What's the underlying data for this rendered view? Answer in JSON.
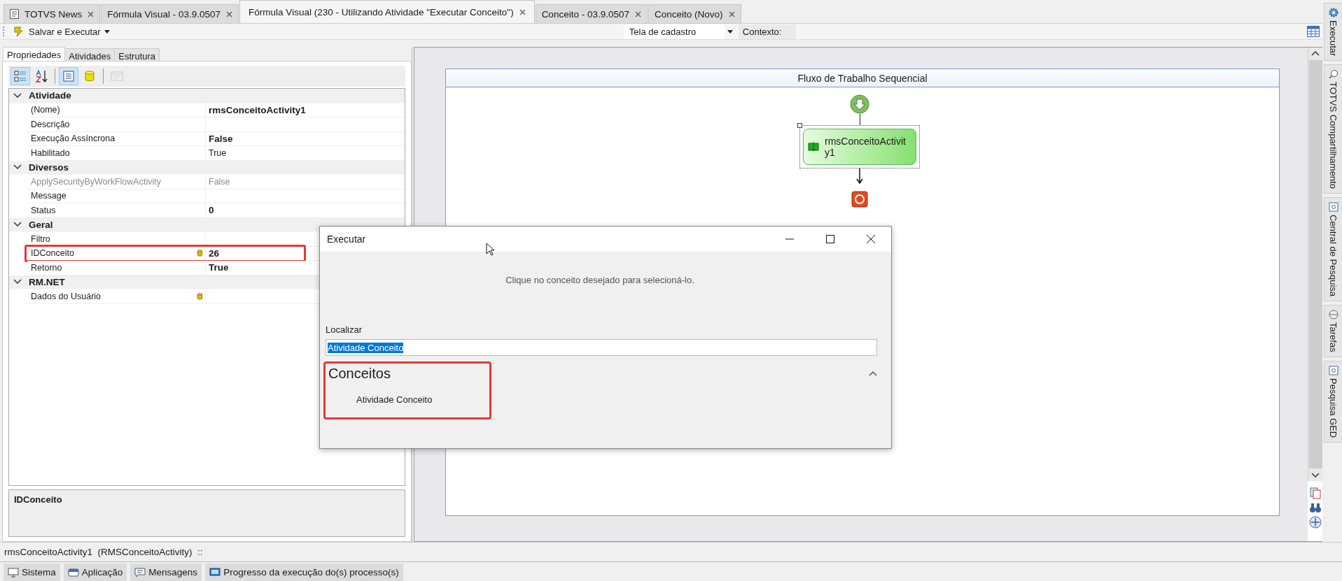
{
  "document_tabs": [
    {
      "label": "TOTVS News",
      "selected": false,
      "kind": "news"
    },
    {
      "label": "Fórmula Visual - 03.9.0507",
      "selected": false,
      "kind": "plain"
    },
    {
      "label": "Fórmula Visual (230 - Utilizando Atividade \"Executar Conceito\")",
      "selected": true,
      "kind": "plain"
    },
    {
      "label": "Conceito - 03.9.0507",
      "selected": false,
      "kind": "plain"
    },
    {
      "label": "Conceito (Novo)",
      "selected": false,
      "kind": "plain"
    }
  ],
  "toolbar": {
    "run_button": "Salvar e Executar",
    "screen_select": "Tela de cadastro",
    "context_label": "Contexto:"
  },
  "left_panel": {
    "tabs": [
      {
        "label": "Propriedades",
        "selected": true
      },
      {
        "label": "Atividades",
        "selected": false
      },
      {
        "label": "Estrutura",
        "selected": false
      }
    ],
    "grid_tools": [
      {
        "kind": "categorized",
        "selected": true,
        "disabled": false
      },
      {
        "kind": "alphabetical",
        "selected": false,
        "disabled": false
      },
      {
        "kind": "properties",
        "selected": true,
        "disabled": false
      },
      {
        "kind": "database",
        "selected": false,
        "disabled": false
      },
      {
        "kind": "events",
        "selected": false,
        "disabled": true
      }
    ],
    "categories": [
      {
        "name": "Atividade",
        "expanded": true,
        "properties": [
          {
            "name": "(Nome)",
            "value": "rmsConceitoActivity1",
            "modified": true,
            "disabled": false,
            "bound": false,
            "highlighted": false
          },
          {
            "name": "Descrição",
            "disabled": false,
            "bound": false,
            "highlighted": false
          },
          {
            "name": "Execução Assíncrona",
            "value": "False",
            "modified": true,
            "disabled": false,
            "bound": false,
            "highlighted": false
          },
          {
            "name": "Habilitado",
            "value": "True",
            "modified": false,
            "disabled": false,
            "bound": false,
            "highlighted": false
          }
        ]
      },
      {
        "name": "Diversos",
        "expanded": true,
        "properties": [
          {
            "name": "ApplySecurityByWorkFlowActivity",
            "value": "False",
            "modified": false,
            "disabled": true,
            "bound": false,
            "highlighted": false
          },
          {
            "name": "Message",
            "disabled": false,
            "bound": false,
            "highlighted": false
          },
          {
            "name": "Status",
            "value": "0",
            "modified": true,
            "disabled": false,
            "bound": false,
            "highlighted": false
          }
        ]
      },
      {
        "name": "Geral",
        "expanded": true,
        "properties": [
          {
            "name": "Filtro",
            "disabled": false,
            "bound": false,
            "highlighted": false
          },
          {
            "name": "IDConceito",
            "value": "26",
            "modified": true,
            "disabled": false,
            "bound": true,
            "highlighted": true
          },
          {
            "name": "Retorno",
            "value": "True",
            "modified": true,
            "disabled": false,
            "bound": false,
            "highlighted": false
          }
        ]
      },
      {
        "name": "RM.NET",
        "expanded": true,
        "properties": [
          {
            "name": "Dados do Usuário",
            "disabled": false,
            "bound": true,
            "highlighted": false
          }
        ]
      }
    ],
    "help": {
      "title": "IDConceito"
    }
  },
  "designer": {
    "title": "Fluxo de Trabalho Sequencial",
    "activity": {
      "label": "rmsConceitoActivity1",
      "selected": true
    }
  },
  "dialog": {
    "title": "Executar",
    "hint": "Clique no conceito desejado para selecioná-lo.",
    "search_label": "Localizar",
    "search_value": "Atividade Conceito",
    "text_selected": true,
    "group": {
      "title": "Conceitos",
      "expanded": true,
      "highlighted": true,
      "items": [
        "Atividade Conceito"
      ]
    }
  },
  "side_tabs": [
    {
      "label": "Executar",
      "kind": "gear"
    },
    {
      "label": "TOTVS Compartilhamento",
      "kind": "search"
    },
    {
      "label": "Central de Pesquisa",
      "kind": "doc"
    },
    {
      "label": "Tarefas",
      "kind": "pin"
    },
    {
      "label": "Pesquisa GED",
      "kind": "doc"
    }
  ],
  "status_line": "rmsConceitoActivity1  (RMSConceitoActivity)  ::",
  "bottom_tabs": [
    {
      "label": "Sistema",
      "kind": "monitor"
    },
    {
      "label": "Aplicação",
      "kind": "window"
    },
    {
      "label": "Mensagens",
      "kind": "message"
    },
    {
      "label": "Progresso da execução do(s) processo(s)",
      "kind": "progress"
    }
  ]
}
